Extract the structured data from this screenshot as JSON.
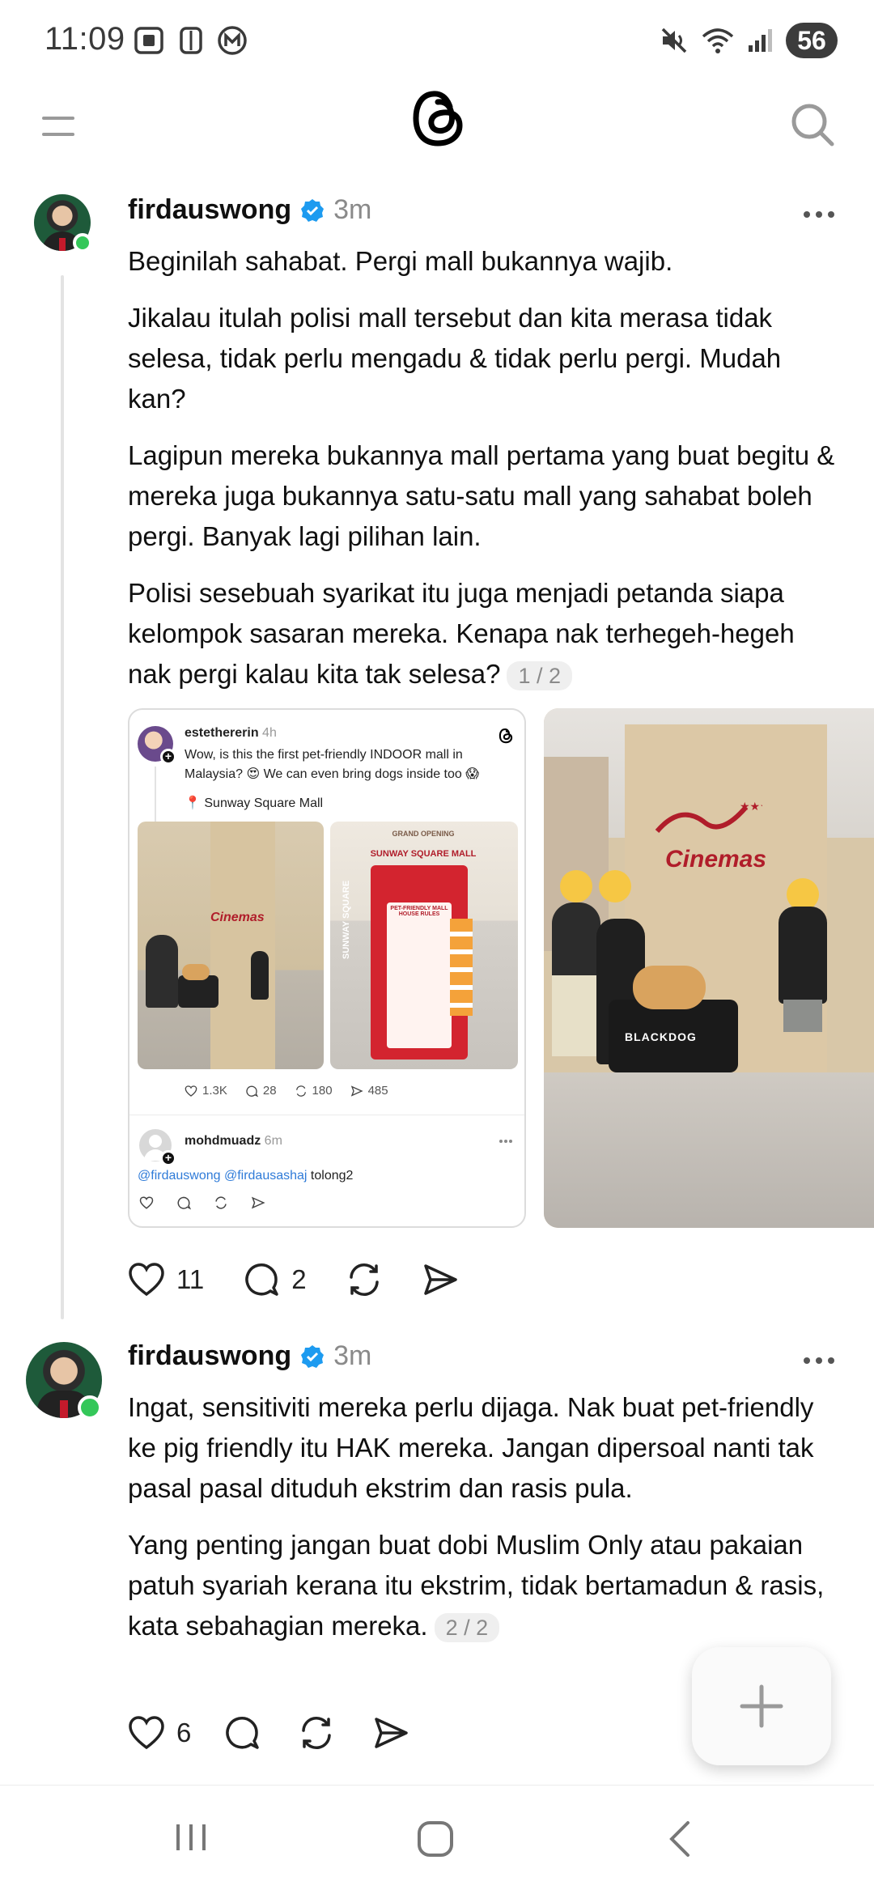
{
  "status_bar": {
    "time": "11:09",
    "battery": "56",
    "icons": [
      "screenshot-icon",
      "nfc-icon",
      "m-icon",
      "mute-icon",
      "wifi-icon",
      "signal-icon"
    ]
  },
  "header": {
    "menu_icon": "menu-icon",
    "logo": "threads-logo",
    "search_icon": "search-icon"
  },
  "posts": [
    {
      "username": "firdauswong",
      "verified": true,
      "time": "3m",
      "paragraphs": [
        "Beginilah sahabat. Pergi mall bukannya wajib.",
        "Jikalau itulah polisi mall tersebut dan kita merasa tidak selesa, tidak perlu mengadu & tidak perlu pergi. Mudah kan?",
        "Lagipun mereka bukannya mall pertama yang buat begitu & mereka juga bukannya satu-satu mall yang sahabat boleh pergi. Banyak lagi pilihan lain.",
        "Polisi sesebuah syarikat itu juga menjadi petanda siapa kelompok sasaran mereka. Kenapa nak terhegeh-hegeh nak pergi kalau kita tak selesa?"
      ],
      "counter": "1 / 2",
      "likes": "11",
      "replies": "2",
      "embedded": {
        "username": "estethererin",
        "time": "4h",
        "text_1": "Wow, is this the first pet-friendly INDOOR mall in",
        "text_2": "Malaysia? 😍 We can even bring dogs inside too 😱",
        "location": "📍 Sunway Square Mall",
        "likes": "1.3K",
        "replies": "28",
        "reposts": "180",
        "shares": "485",
        "reply_user": "mohdmuadz",
        "reply_time": "6m",
        "reply_mentions": "@firdauswong @firdausashaj",
        "reply_text": " tolong2",
        "sign_1": "GRAND OPENING",
        "sign_2": "SUNWAY SQUARE MALL",
        "sign_3": "SUNWAY SQUARE",
        "sign_4": "PET-FRIENDLY MALL HOUSE RULES",
        "cinema_brand": "Cinemas"
      },
      "photo": {
        "brand": "Cinemas",
        "wagon_label": "BLACKDOG"
      }
    },
    {
      "username": "firdauswong",
      "verified": true,
      "time": "3m",
      "paragraphs": [
        "Ingat, sensitiviti mereka perlu dijaga. Nak buat pet-friendly ke pig friendly itu HAK mereka. Jangan dipersoal nanti tak pasal pasal dituduh ekstrim dan rasis pula.",
        "Yang penting jangan buat dobi Muslim Only atau pakaian patuh syariah kerana itu ekstrim, tidak bertamadun & rasis, kata sebahagian mereka."
      ],
      "counter": "2 / 2",
      "likes": "6"
    }
  ],
  "fab": {
    "icon": "plus-icon"
  },
  "nav": {
    "icons": [
      "recents-icon",
      "home-icon",
      "back-icon"
    ]
  }
}
